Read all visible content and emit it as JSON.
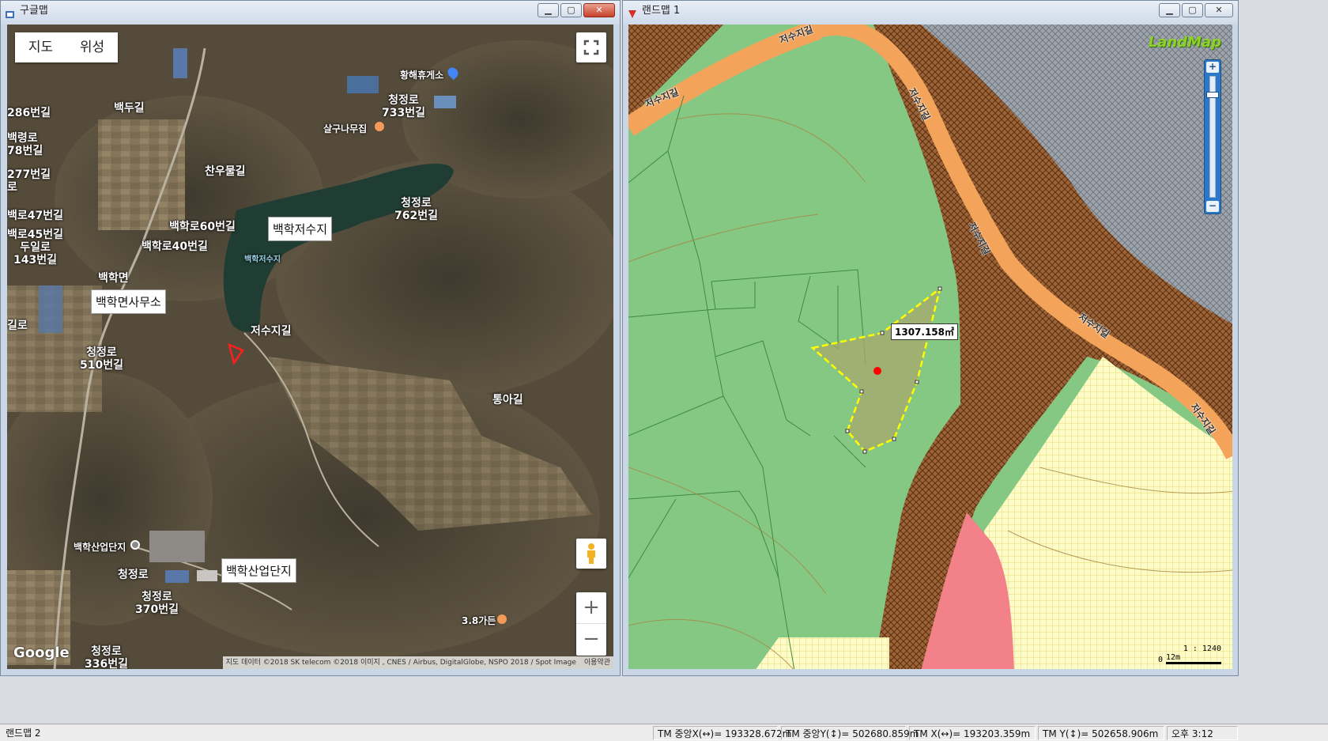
{
  "google_window": {
    "title": "구글맵",
    "map_type": {
      "map": "지도",
      "satellite": "위성"
    },
    "labels": [
      {
        "id": "baekdugil",
        "text": "백두길"
      },
      {
        "id": "reservoir_box",
        "text": "백학저수지"
      },
      {
        "id": "reservoir_small",
        "text": "백학저수지"
      },
      {
        "id": "rest_area",
        "text": "황해휴게소"
      },
      {
        "id": "cheongjeongro733",
        "text": "청정로\n733번길"
      },
      {
        "id": "salgu",
        "text": "살구나무집"
      },
      {
        "id": "chanumul",
        "text": "찬우물길"
      },
      {
        "id": "cheongjeongro762",
        "text": "청정로\n762번길"
      },
      {
        "id": "baekhakro60",
        "text": "백학로60번길"
      },
      {
        "id": "baekhakro40",
        "text": "백학로40번길"
      },
      {
        "id": "baekhakmyeon",
        "text": "백학면"
      },
      {
        "id": "office_box",
        "text": "백학면사무소"
      },
      {
        "id": "jeosuji",
        "text": "저수지길"
      },
      {
        "id": "cheongjeongro510",
        "text": "청정로\n510번길"
      },
      {
        "id": "tongagil",
        "text": "통아길"
      },
      {
        "id": "industrial_small",
        "text": "백학산업단지"
      },
      {
        "id": "industrial_box",
        "text": "백학산업단지"
      },
      {
        "id": "cheongjeongro",
        "text": "청정로"
      },
      {
        "id": "cheongjeongro370",
        "text": "청정로\n370번길"
      },
      {
        "id": "cheongjeongro336",
        "text": "청정로\n336번길"
      },
      {
        "id": "garden38",
        "text": "3.8가든"
      },
      {
        "id": "l286",
        "text": "286번길"
      },
      {
        "id": "l_baekryeong",
        "text": "백령로\n78번길"
      },
      {
        "id": "l277",
        "text": "277번길\n로"
      },
      {
        "id": "l47",
        "text": "백로47번길"
      },
      {
        "id": "l45",
        "text": "백로45번길\n두일로\n143번길"
      },
      {
        "id": "l_ro",
        "text": "길로"
      }
    ],
    "logo": "Google",
    "attribution": "지도 데이터 ©2018 SK telecom ©2018 이미지 , CNES / Airbus, DigitalGlobe, NSPO 2018 / Spot Image",
    "terms": "이용약관",
    "zoom_in": "+",
    "zoom_out": "−"
  },
  "landmap_window": {
    "title": "랜드맵 1",
    "logo": "LandMap",
    "area_label": "1307.158㎡",
    "road_labels": [
      "저수지길",
      "저수지길",
      "저수지길",
      "저수지길",
      "저수지길",
      "저수지길"
    ],
    "zoom_in": "+",
    "zoom_out": "−",
    "scale_ratio": "1 : 1240",
    "scale_zero": "0",
    "scale_dist": "12m"
  },
  "status_bar": {
    "app": "랜드맵 2",
    "tm_cx": "TM 중앙X(↔)= 193328.672m",
    "tm_cy": "TM 중앙Y(↕)= 502680.859m",
    "tm_x": "TM X(↔)= 193203.359m",
    "tm_y": "TM Y(↕)= 502658.906m",
    "time": "오후 3:12"
  },
  "colors": {
    "accent": "#2c78c8",
    "forest": "#84c883",
    "hatch": "#9c6436",
    "parcel_outline": "#ffff00",
    "road": "#f4a45a",
    "marker": "#ff0000"
  }
}
